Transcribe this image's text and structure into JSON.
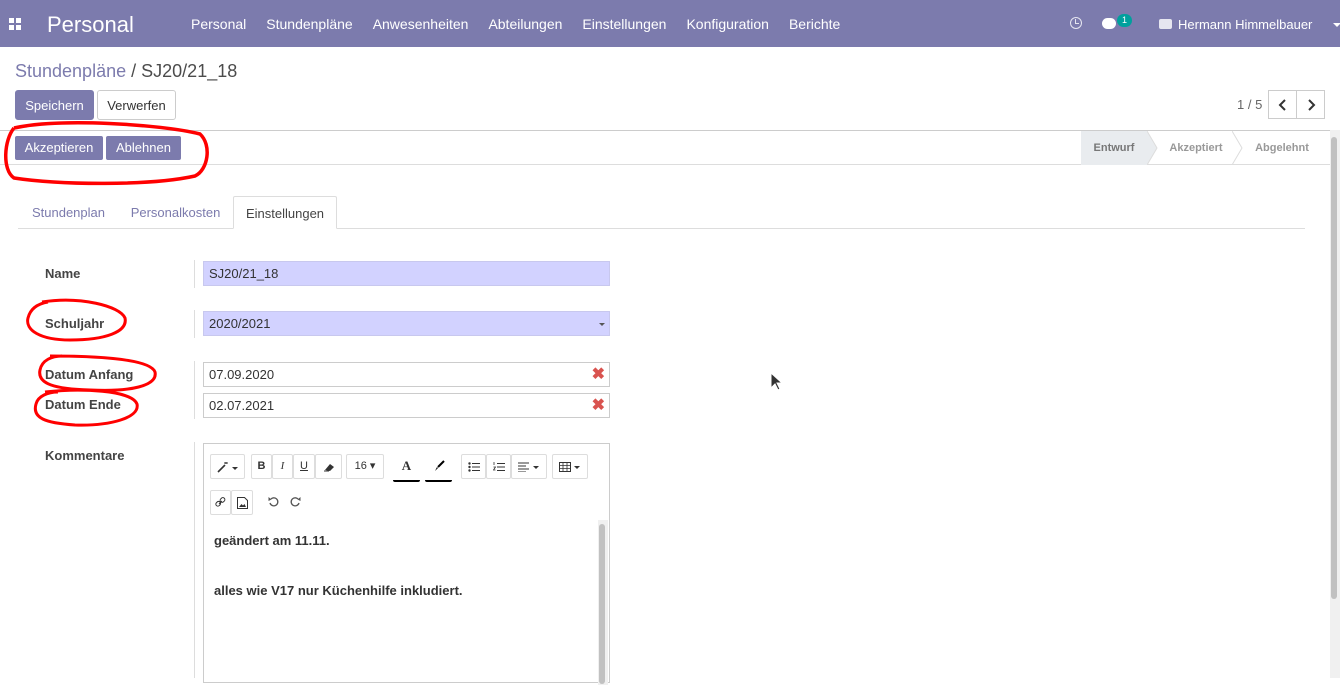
{
  "nav": {
    "brand": "Personal",
    "menu": [
      "Personal",
      "Stundenpläne",
      "Anwesenheiten",
      "Abteilungen",
      "Einstellungen",
      "Konfiguration",
      "Berichte"
    ],
    "chat_badge": "1",
    "user_name": "Hermann Himmelbauer"
  },
  "control": {
    "breadcrumb_parent": "Stundenpläne",
    "breadcrumb_sep": "/",
    "breadcrumb_current": "SJ20/21_18",
    "save_label": "Speichern",
    "discard_label": "Verwerfen",
    "pager": "1 / 5"
  },
  "status": {
    "accept_label": "Akzeptieren",
    "reject_label": "Ablehnen",
    "stages": [
      "Entwurf",
      "Akzeptiert",
      "Abgelehnt"
    ],
    "active_stage": "Entwurf"
  },
  "tabs": [
    "Stundenplan",
    "Personalkosten",
    "Einstellungen"
  ],
  "active_tab": "Einstellungen",
  "form": {
    "name_label": "Name",
    "name_value": "SJ20/21_18",
    "schoolyear_label": "Schuljahr",
    "schoolyear_value": "2020/2021",
    "start_label": "Datum Anfang",
    "start_value": "07.09.2020",
    "end_label": "Datum Ende",
    "end_value": "02.07.2021",
    "comments_label": "Kommentare"
  },
  "editor": {
    "font_size": "16",
    "line1": "geändert am 11.11.",
    "line2": "alles wie V17 nur Küchenhilfe inkludiert."
  },
  "colors": {
    "brand": "#7c7bad",
    "required_field": "#d2d2ff",
    "annotation": "#ff0000"
  }
}
